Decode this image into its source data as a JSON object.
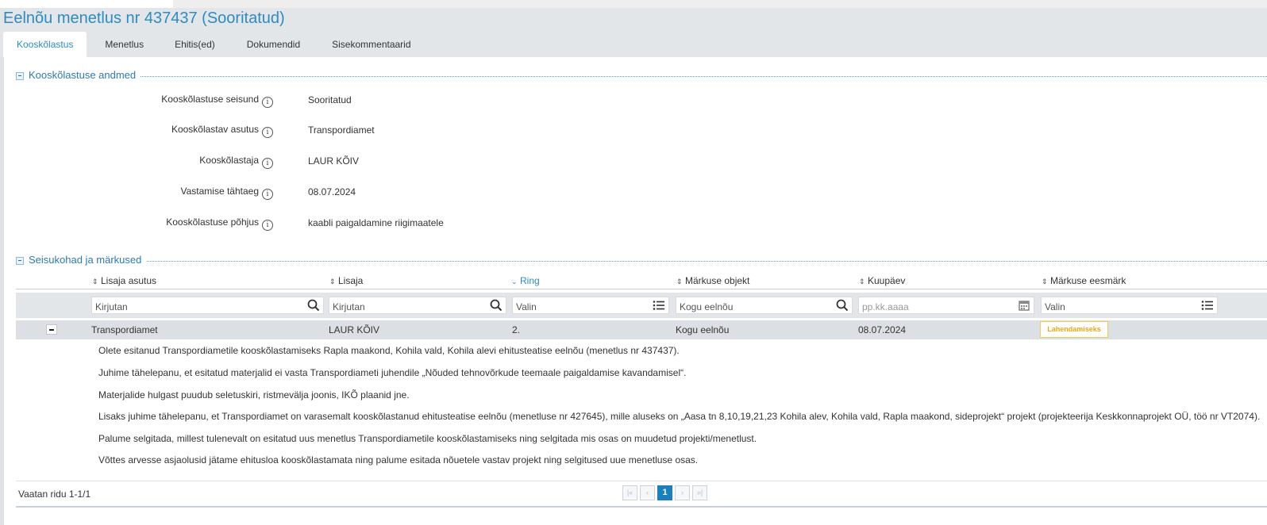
{
  "title": "Eelnõu menetlus nr 437437 (Sooritatud)",
  "tabs": [
    "Kooskõlastus",
    "Menetlus",
    "Ehitis(ed)",
    "Dokumendid",
    "Sisekommentaarid"
  ],
  "section1": {
    "title": "Kooskõlastuse andmed",
    "fields": [
      {
        "label": "Kooskõlastuse seisund",
        "value": "Sooritatud"
      },
      {
        "label": "Kooskõlastav asutus",
        "value": "Transpordiamet"
      },
      {
        "label": "Kooskõlastaja",
        "value": "LAUR KÕIV"
      },
      {
        "label": "Vastamise tähtaeg",
        "value": "08.07.2024"
      },
      {
        "label": "Kooskõlastuse põhjus",
        "value": "kaabli paigaldamine riigimaatele"
      }
    ]
  },
  "section2": {
    "title": "Seisukohad ja märkused",
    "columns": [
      "Lisaja asutus",
      "Lisaja",
      "Ring",
      "Märkuse objekt",
      "Kuupäev",
      "Märkuse eesmärk"
    ],
    "filters": [
      "Kirjutan",
      "Kirjutan",
      "Valin",
      "Kogu eelnõu",
      "pp.kk.aaaa",
      "Valin"
    ],
    "row": {
      "asutus": "Transpordiamet",
      "lisaja": "LAUR KÕIV",
      "ring": "2.",
      "objekt": "Kogu eelnõu",
      "kuupaev": "08.07.2024",
      "eesmark": "Lahendamiseks"
    },
    "details": [
      "Olete esitanud Transpordiametile kooskõlastamiseks Rapla maakond, Kohila vald, Kohila alevi ehitusteatise eelnõu (menetlus nr 437437).",
      "Juhime tähelepanu, et esitatud materjalid ei vasta Transpordiameti juhendile „Nõuded tehnovõrkude teemaale paigaldamise kavandamisel“.",
      "Materjalide hulgast puudub seletuskiri, ristmevälja joonis, IKÕ plaanid jne.",
      "Lisaks juhime tähelepanu, et Transpordiamet on varasemalt kooskõlastanud ehitusteatise eelnõu (menetluse nr 427645), mille aluseks on „Aasa tn 8,10,19,21,23 Kohila alev, Kohila vald, Rapla maakond, sideprojekt“ projekt (projekteerija Keskkonnaprojekt OÜ, töö nr VT2074).",
      "Palume selgitada, millest tulenevalt on esitatud uus menetlus Transpordiametile kooskõlastamiseks ning selgitada mis osas on muudetud projekti/menetlust.",
      "Võttes arvesse asjaolusid jätame ehitusloa kooskõlastamata ning palume esitada nõuetele vastav projekt ning selgitused uue menetluse osas."
    ],
    "footer": "Vaatan ridu 1-1/1",
    "page": "1"
  },
  "colors": {
    "accent": "#2e8bc0",
    "badge": "#f2c94c"
  }
}
